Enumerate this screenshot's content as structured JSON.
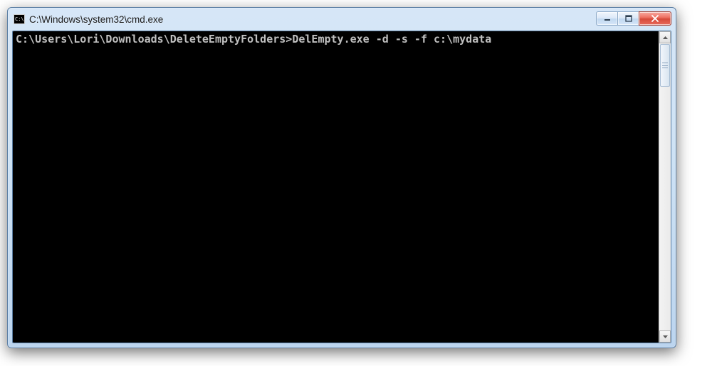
{
  "window": {
    "title": "C:\\Windows\\system32\\cmd.exe",
    "icon_label": "C:\\"
  },
  "terminal": {
    "prompt": "C:\\Users\\Lori\\Downloads\\DeleteEmptyFolders>",
    "command": "DelEmpty.exe -d -s -f c:\\mydata"
  },
  "controls": {
    "minimize": "minimize",
    "maximize": "maximize",
    "close": "close"
  }
}
